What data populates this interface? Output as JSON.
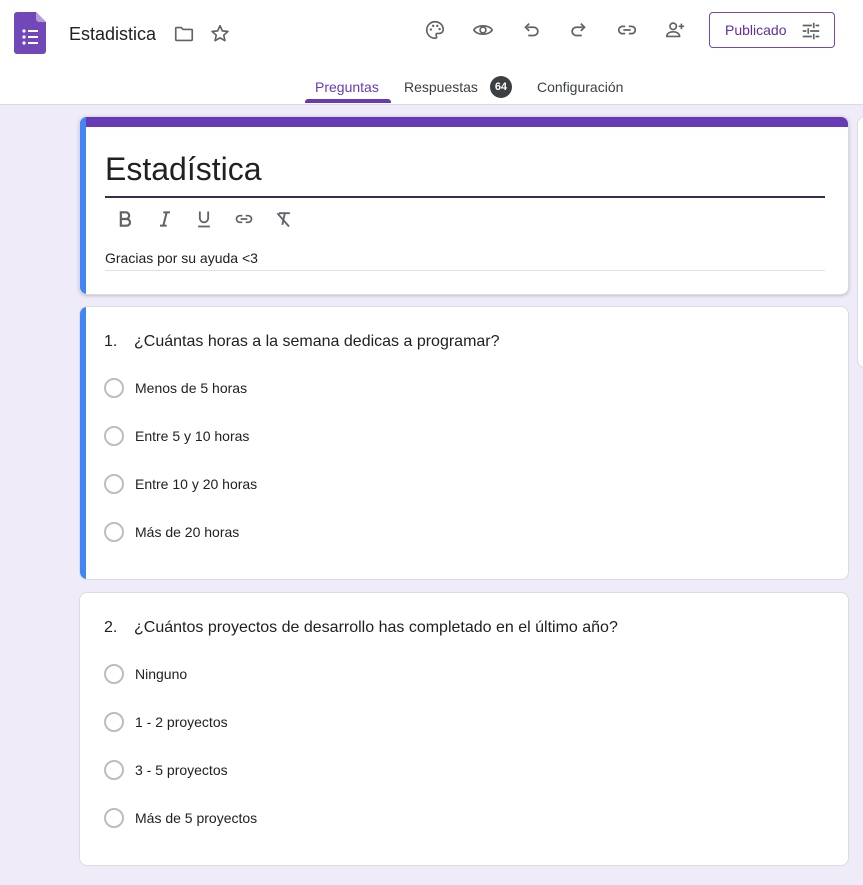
{
  "header": {
    "doc_title": "Estadistica",
    "publish_label": "Publicado"
  },
  "tabs": [
    {
      "label": "Preguntas"
    },
    {
      "label": "Respuestas",
      "badge": "64"
    },
    {
      "label": "Configuración"
    }
  ],
  "form": {
    "title": "Estadística",
    "description": "Gracias por su ayuda <3"
  },
  "questions": [
    {
      "number": "1.",
      "text": "¿Cuántas horas a la semana dedicas a programar?",
      "options": [
        "Menos de 5 horas",
        "Entre 5 y 10 horas",
        "Entre 10 y 20 horas",
        "Más de 20 horas"
      ]
    },
    {
      "number": "2.",
      "text": "¿Cuántos proyectos de desarrollo has completado en el último año?",
      "options": [
        "Ninguno",
        "1 - 2 proyectos",
        "3 - 5 proyectos",
        "Más de 5 proyectos"
      ]
    }
  ],
  "icons": {
    "app": "forms-logo-icon",
    "folder": "folder-icon",
    "star": "star-icon",
    "palette": "palette-icon",
    "preview": "eye-icon",
    "undo": "undo-icon",
    "redo": "redo-icon",
    "link": "link-icon",
    "add_collaborator": "person-add-icon",
    "publish_options": "tune-icon"
  },
  "colors": {
    "accent": "#673ab7",
    "active_question": "#4285f4",
    "background": "#f0ebf8"
  }
}
